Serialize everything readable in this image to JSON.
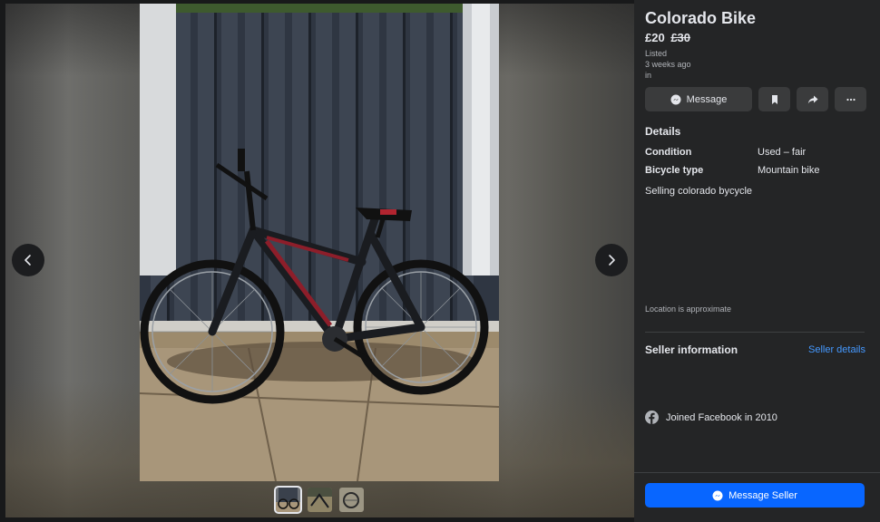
{
  "listing": {
    "title": "Colorado Bike",
    "price": "£20",
    "original_price": "£30",
    "listed_label": "Listed",
    "listed_time": "3 weeks ago",
    "location_prefix": "in"
  },
  "actions": {
    "message_label": "Message",
    "save_icon": "bookmark-icon",
    "share_icon": "share-icon",
    "more_icon": "more-icon"
  },
  "details": {
    "heading": "Details",
    "rows": [
      {
        "key": "Condition",
        "value": "Used – fair"
      },
      {
        "key": "Bicycle type",
        "value": "Mountain bike"
      }
    ],
    "description": "Selling colorado bycycle",
    "location_note": "Location is approximate"
  },
  "seller": {
    "heading": "Seller information",
    "details_link": "Seller details",
    "joined": "Joined Facebook in 2010"
  },
  "footer": {
    "message_seller_label": "Message Seller"
  },
  "gallery": {
    "thumbnail_count": 3,
    "active_index": 0
  },
  "colors": {
    "panel_bg": "#242526",
    "accent": "#0866ff",
    "link": "#4599ff"
  }
}
